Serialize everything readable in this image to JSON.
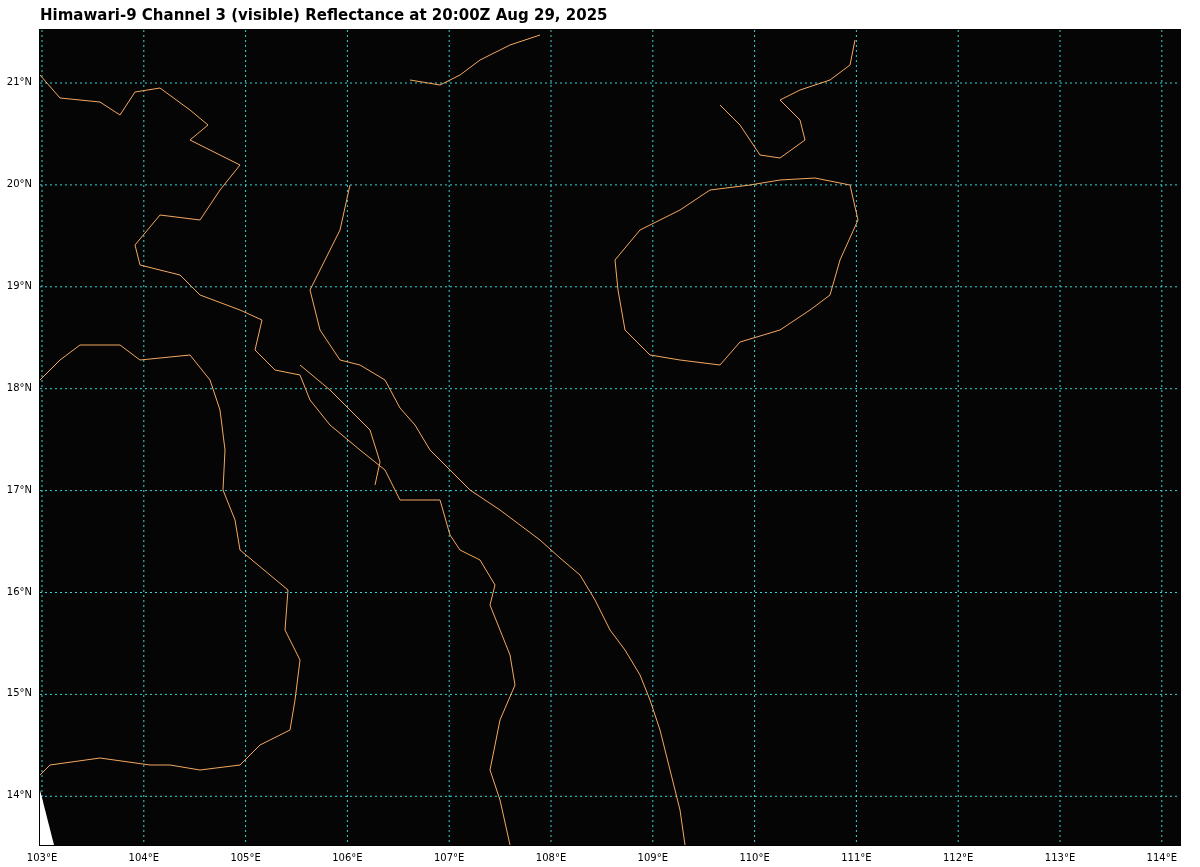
{
  "title": "Himawari-9 Channel 3 (visible) Reflectance at 20:00Z Aug 29, 2025",
  "map": {
    "lon_labels": [
      "103°E",
      "104°E",
      "105°E",
      "106°E",
      "107°E",
      "108°E",
      "109°E",
      "110°E",
      "111°E",
      "112°E",
      "113°E",
      "114°E"
    ],
    "lat_labels": [
      "21°N",
      "20°N",
      "19°N",
      "18°N",
      "17°N",
      "16°N",
      "15°N",
      "14°N"
    ]
  }
}
